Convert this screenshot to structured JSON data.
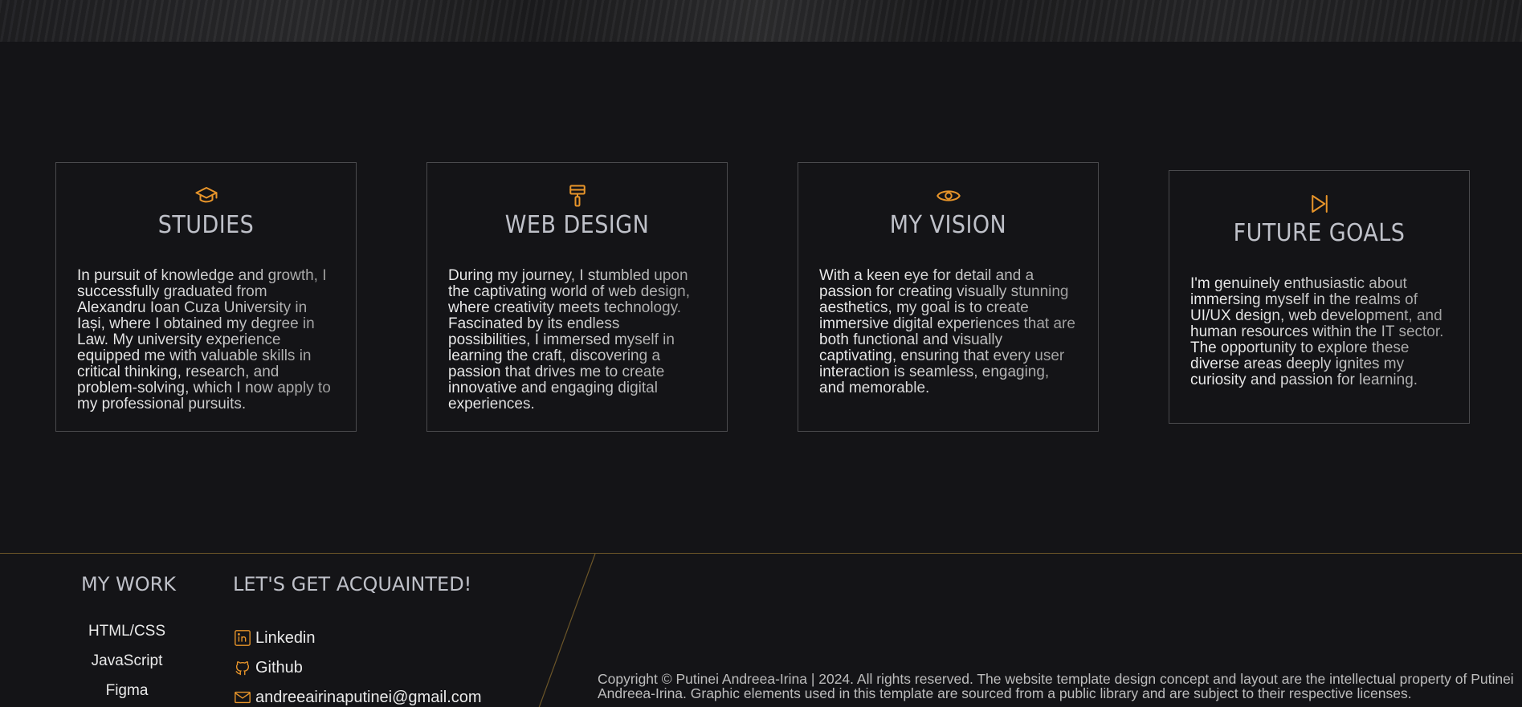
{
  "cards": [
    {
      "icon": "graduation-cap-icon",
      "title": "STUDIES",
      "text": "In pursuit of knowledge and growth, I successfully graduated from Alexandru Ioan Cuza University in Iași, where I obtained my degree in Law. My university experience equipped me with valuable skills in critical thinking, research, and problem-solving, which I now apply to my professional pursuits."
    },
    {
      "icon": "paint-roller-icon",
      "title": "WEB DESIGN",
      "text": "During my journey, I stumbled upon the captivating world of web design, where creativity meets technology. Fascinated by its endless possibilities, I immersed myself in learning the craft, discovering a passion that drives me to create innovative and engaging digital experiences."
    },
    {
      "icon": "eye-icon",
      "title": "MY VISION",
      "text": "With a keen eye for detail and a passion for creating visually stunning aesthetics, my goal is to create immersive digital experiences that are both functional and visually captivating, ensuring that every user interaction is seamless, engaging, and memorable."
    },
    {
      "icon": "skip-forward-icon",
      "title": "FUTURE GOALS",
      "text": "I'm genuinely enthusiastic about immersing myself in the realms of UI/UX design, web development, and human resources within the IT sector. The opportunity to explore these diverse areas deeply ignites my curiosity and passion for learning."
    }
  ],
  "footer": {
    "work_title": "MY WORK",
    "work_items": [
      "HTML/CSS",
      "JavaScript",
      "Figma"
    ],
    "contact_title": "LET'S GET ACQUAINTED!",
    "contacts": [
      {
        "icon": "linkedin-icon",
        "label": "Linkedin"
      },
      {
        "icon": "github-icon",
        "label": "Github"
      },
      {
        "icon": "mail-icon",
        "label": "andreeairinaputinei@gmail.com"
      }
    ],
    "copyright": "Copyright © Putinei Andreea-Irina | 2024. All rights reserved. The website template design concept and layout are the intellectual property of Putinei Andreea-Irina. Graphic elements used in this template are sourced from a public library and are subject to their respective licenses.",
    "accent_color": "#e8952a"
  }
}
